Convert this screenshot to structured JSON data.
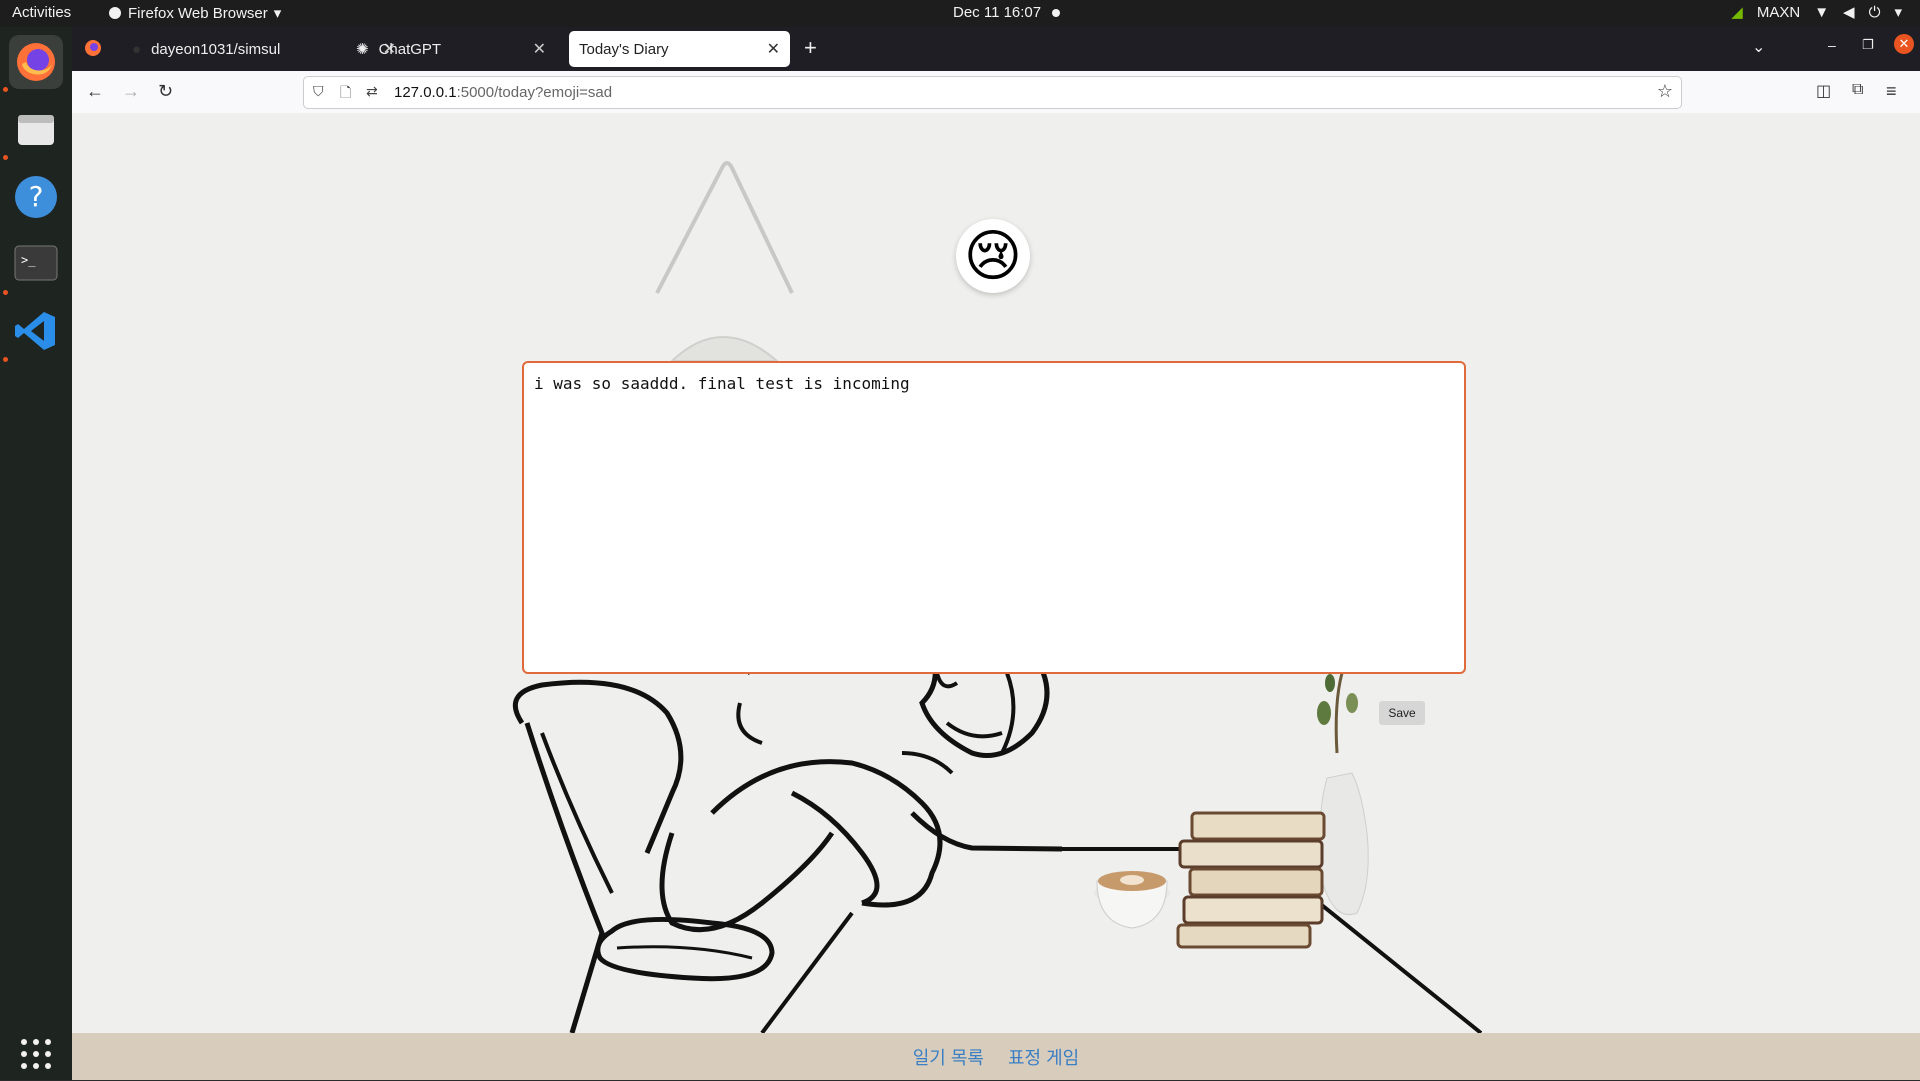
{
  "system": {
    "activities": "Activities",
    "app_name": "Firefox Web Browser",
    "clock": "Dec 11  16:07",
    "power_mode": "MAXN"
  },
  "tabs": [
    {
      "label": "dayeon1031/simsul"
    },
    {
      "label": "ChatGPT"
    },
    {
      "label": "Today's Diary"
    }
  ],
  "url": {
    "host": "127.0.0.1",
    "rest": ":5000/today?emoji=sad"
  },
  "diary": {
    "text": "i was so saaddd. final test is incoming",
    "emoji": "😢"
  },
  "save_label": "Save",
  "footer": {
    "link1": "일기 목록",
    "link2": "표정 게임"
  },
  "colors": {
    "accent": "#e06a3c",
    "footer_bg": "#d8ccbd",
    "link": "#3a7fc4"
  }
}
